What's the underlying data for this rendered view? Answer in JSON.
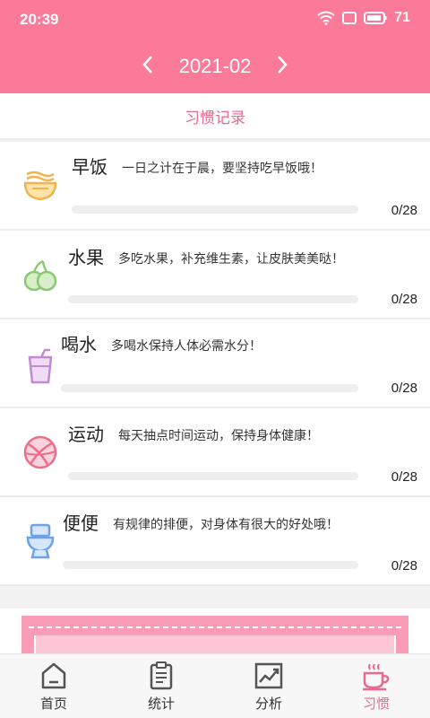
{
  "status_bar": {
    "time": "20:39",
    "battery": "71"
  },
  "header": {
    "month": "2021-02",
    "prev_icon": "chevron-left-icon",
    "next_icon": "chevron-right-icon"
  },
  "section_title": "习惯记录",
  "habits": [
    {
      "name": "早饭",
      "desc": "一日之计在于晨，要坚持吃早饭哦！",
      "count": "0/28",
      "progress": 0,
      "icon": "noodle-bowl-icon",
      "color": "#f6c36b"
    },
    {
      "name": "水果",
      "desc": "多吃水果，补充维生素，让皮肤美美哒！",
      "count": "0/28",
      "progress": 0,
      "icon": "fruit-icon",
      "color": "#9fd38a"
    },
    {
      "name": "喝水",
      "desc": "多喝水保持人体必需水分！",
      "count": "0/28",
      "progress": 0,
      "icon": "cup-icon",
      "color": "#d6a6e0"
    },
    {
      "name": "运动",
      "desc": "每天抽点时间运动，保持身体健康！",
      "count": "0/28",
      "progress": 0,
      "icon": "ball-icon",
      "color": "#f08aa0"
    },
    {
      "name": "便便",
      "desc": "有规律的排便，对身体有很大的好处哦！",
      "count": "0/28",
      "progress": 0,
      "icon": "toilet-icon",
      "color": "#8fb8f0"
    }
  ],
  "tabs": [
    {
      "label": "首页",
      "icon": "home-icon",
      "active": false
    },
    {
      "label": "统计",
      "icon": "clipboard-icon",
      "active": false
    },
    {
      "label": "分析",
      "icon": "chart-icon",
      "active": false
    },
    {
      "label": "习惯",
      "icon": "coffee-cup-icon",
      "active": true
    }
  ],
  "colors": {
    "brand": "#fb7a9a",
    "accent_text": "#e86a8d"
  }
}
